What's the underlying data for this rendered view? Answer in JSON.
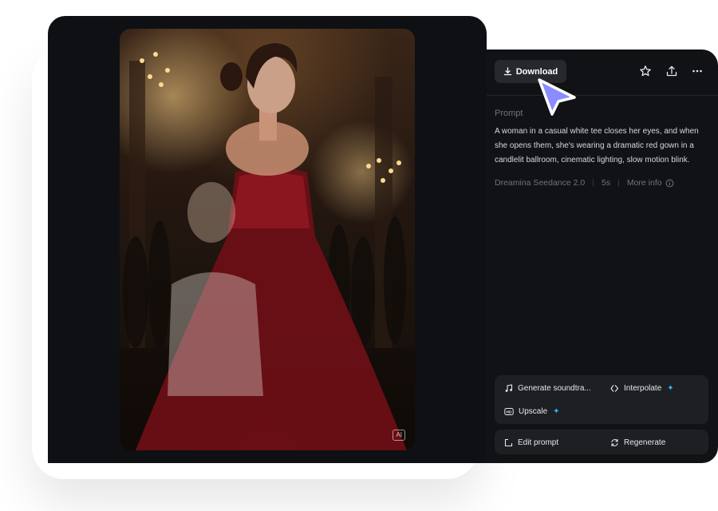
{
  "media": {
    "badge": "AI",
    "description_icon": "ballroom-video-frame"
  },
  "toolbar": {
    "download_label": "Download",
    "icons": [
      "download-icon",
      "star-icon",
      "share-icon",
      "more-icon"
    ]
  },
  "prompt": {
    "label": "Prompt",
    "text": "A woman in a casual white tee closes her eyes, and when she opens them, she's wearing a dramatic red gown in a candlelit ballroom, cinematic lighting, slow motion blink."
  },
  "meta": {
    "model": "Dreamina Seedance 2.0",
    "duration": "5s",
    "more_info": "More info"
  },
  "actions": {
    "generate_soundtrack": "Generate soundtra...",
    "interpolate": "Interpolate",
    "upscale": "Upscale",
    "edit_prompt": "Edit prompt",
    "regenerate": "Regenerate"
  },
  "colors": {
    "panel_bg": "#111215",
    "button_bg": "#26282d",
    "accent_spark": "#2fb7ff",
    "cursor": "#8a8cff"
  }
}
